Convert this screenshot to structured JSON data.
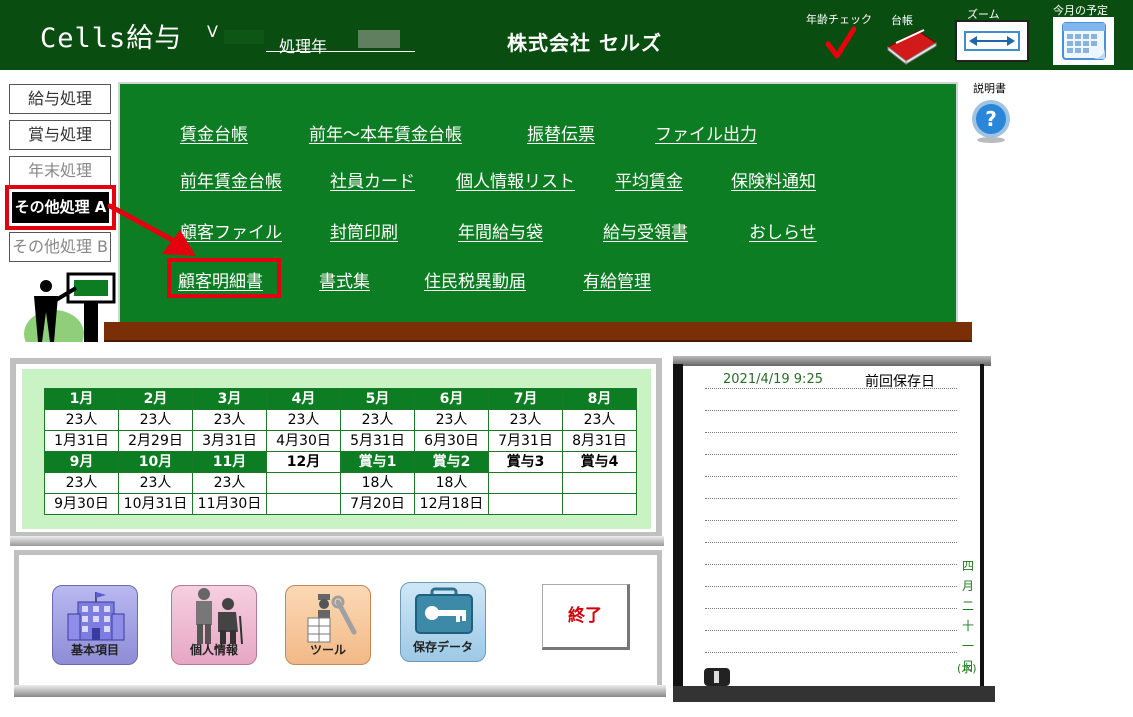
{
  "header": {
    "app_title": "Cells給与",
    "version_prefix": "V",
    "year_label": "処理年",
    "company_name": "株式会社 セルズ",
    "age_check_label": "年齢チェック",
    "ledger_label": "台帳",
    "zoom_label": "ズーム",
    "month_plan_label": "今月の予定"
  },
  "nav": {
    "salary": "給与処理",
    "bonus": "賞与処理",
    "year_end": "年末処理",
    "other_a": "その他処理 A",
    "other_b": "その他処理 B"
  },
  "menu": {
    "row1": [
      "賃金台帳",
      "前年～本年賃金台帳",
      "振替伝票",
      "ファイル出力"
    ],
    "row2": [
      "前年賃金台帳",
      "社員カード",
      "個人情報リスト",
      "平均賃金",
      "保険料通知"
    ],
    "row3": [
      "顧客ファイル",
      "封筒印刷",
      "年間給与袋",
      "給与受領書",
      "おしらせ"
    ],
    "row4": [
      "顧客明細書",
      "書式集",
      "住民税異動届",
      "有給管理"
    ]
  },
  "help": {
    "label": "説明書"
  },
  "months": {
    "row1": [
      {
        "header": "1月",
        "count": "23人",
        "date": "1月31日"
      },
      {
        "header": "2月",
        "count": "23人",
        "date": "2月29日"
      },
      {
        "header": "3月",
        "count": "23人",
        "date": "3月31日"
      },
      {
        "header": "4月",
        "count": "23人",
        "date": "4月30日"
      },
      {
        "header": "5月",
        "count": "23人",
        "date": "5月31日"
      },
      {
        "header": "6月",
        "count": "23人",
        "date": "6月30日"
      },
      {
        "header": "7月",
        "count": "23人",
        "date": "7月31日"
      },
      {
        "header": "8月",
        "count": "23人",
        "date": "8月31日"
      }
    ],
    "row2": [
      {
        "header": "9月",
        "count": "23人",
        "date": "9月30日"
      },
      {
        "header": "10月",
        "count": "23人",
        "date": "10月31日"
      },
      {
        "header": "11月",
        "count": "23人",
        "date": "11月30日"
      },
      {
        "header": "12月",
        "count": "",
        "date": ""
      },
      {
        "header": "賞与1",
        "count": "18人",
        "date": "7月20日"
      },
      {
        "header": "賞与2",
        "count": "18人",
        "date": "12月18日"
      },
      {
        "header": "賞与3",
        "count": "",
        "date": ""
      },
      {
        "header": "賞与4",
        "count": "",
        "date": ""
      }
    ]
  },
  "buttons": {
    "basic": "基本項目",
    "personal": "個人情報",
    "tool": "ツール",
    "save": "保存データ",
    "exit": "終了"
  },
  "memo": {
    "save_time": "2021/4/19 9:25",
    "save_label": "前回保存日",
    "date_jp": [
      "四",
      "月",
      "二",
      "十",
      "一",
      "日"
    ],
    "weekday": "(水)"
  },
  "colors": {
    "header_bg": "#0a4d10",
    "board_green": "#0c7d22",
    "highlight_red": "#e50010",
    "table_green": "#1b7a2a"
  }
}
